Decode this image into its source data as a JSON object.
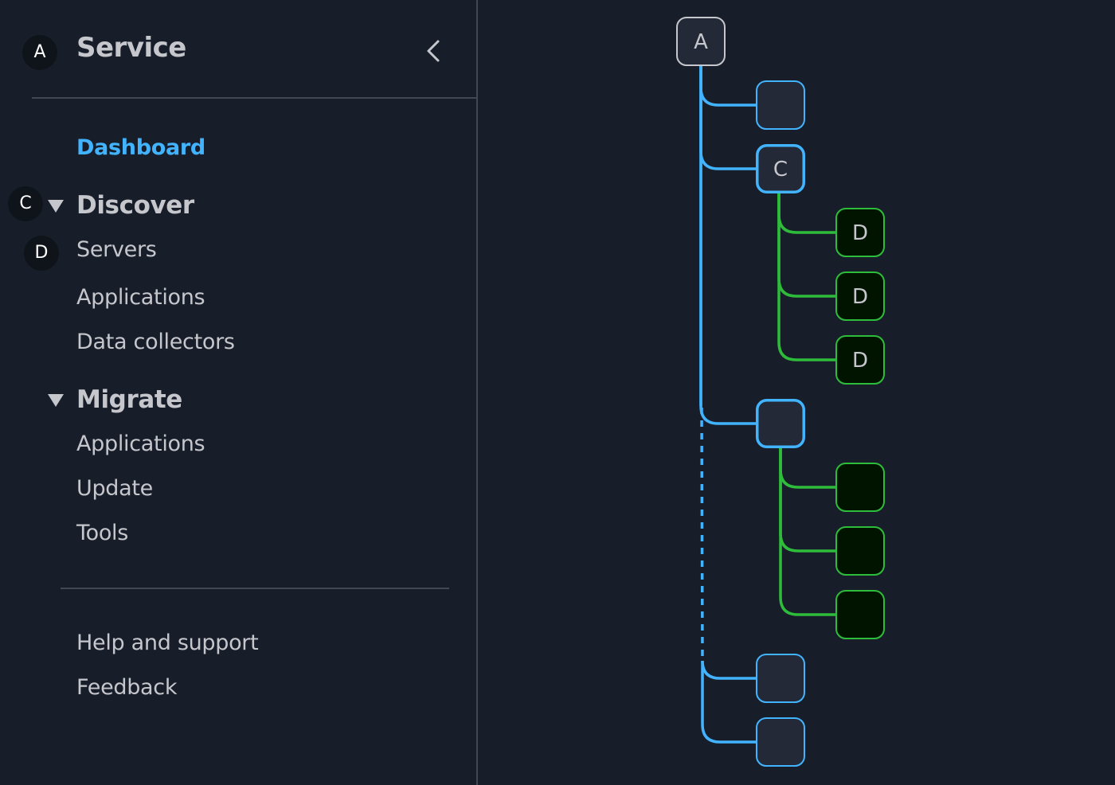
{
  "sidebar": {
    "title": "Service",
    "markers": {
      "a": "A",
      "c": "C",
      "d": "D"
    },
    "collapse_icon": "chevron-left-icon",
    "dashboard": "Dashboard",
    "sections": [
      {
        "label": "Discover",
        "items": [
          "Servers",
          "Applications",
          "Data collectors"
        ]
      },
      {
        "label": "Migrate",
        "items": [
          "Applications",
          "Update",
          "Tools"
        ]
      }
    ],
    "footer": [
      "Help and support",
      "Feedback"
    ]
  },
  "diagram": {
    "colors": {
      "root_border": "#c6c6cd",
      "level1": "#42b4ff",
      "level2": "#2ebd3a",
      "node_fill": "#232936",
      "leaf_fill": "#001400",
      "text": "#c6c6cd"
    },
    "root": {
      "label": "A"
    },
    "children": [
      {
        "label": "",
        "selected": false,
        "children": []
      },
      {
        "label": "C",
        "selected": true,
        "children": [
          {
            "label": "D"
          },
          {
            "label": "D"
          },
          {
            "label": "D"
          }
        ]
      },
      {
        "label": "",
        "selected": true,
        "children": [
          {
            "label": ""
          },
          {
            "label": ""
          },
          {
            "label": ""
          }
        ],
        "dashed_after": true
      },
      {
        "label": "",
        "selected": false,
        "children": []
      },
      {
        "label": "",
        "selected": false,
        "children": []
      }
    ]
  }
}
